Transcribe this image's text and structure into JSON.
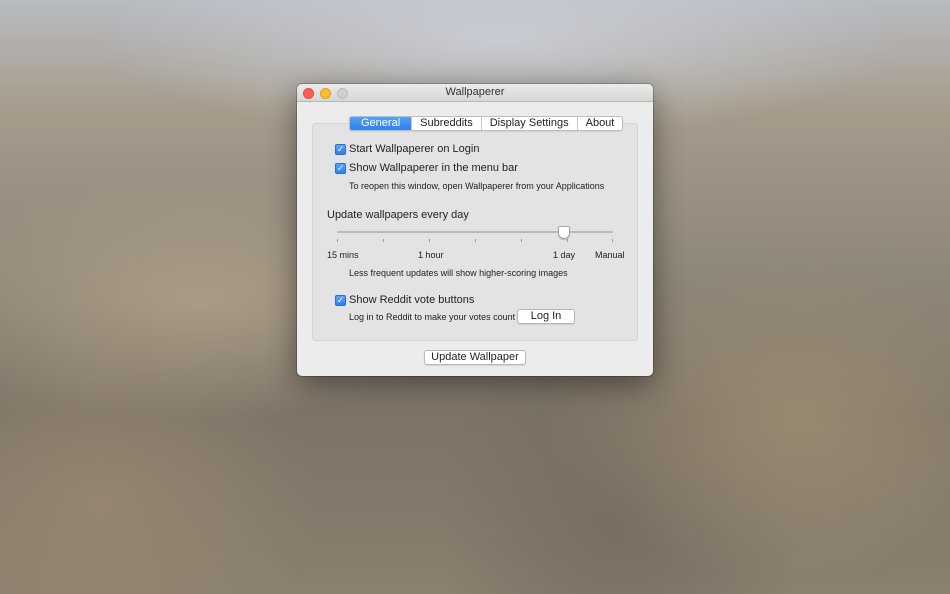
{
  "window": {
    "title": "Wallpaperer"
  },
  "tabs": [
    {
      "label": "General",
      "active": true
    },
    {
      "label": "Subreddits",
      "active": false
    },
    {
      "label": "Display Settings",
      "active": false
    },
    {
      "label": "About",
      "active": false
    }
  ],
  "general": {
    "start_on_login": {
      "label": "Start Wallpaperer on Login",
      "checked": true
    },
    "show_in_menubar": {
      "label": "Show Wallpaperer in the menu bar",
      "checked": true
    },
    "reopen_hint": "To reopen this window, open Wallpaperer from your Applications",
    "update_label": "Update wallpapers every day",
    "slider": {
      "labels": [
        "15 mins",
        "1 hour",
        "1 day",
        "Manual"
      ],
      "selected": "1 day"
    },
    "update_hint": "Less frequent updates will show higher-scoring images",
    "vote_buttons": {
      "label": "Show Reddit vote buttons",
      "checked": true
    },
    "login_hint": "Log in to Reddit to make your votes count",
    "login_button": "Log In"
  },
  "update_button": "Update Wallpaper",
  "colors": {
    "accent": "#2f7ff0",
    "close": "#fc5f57",
    "minimize": "#fdbc2e"
  }
}
